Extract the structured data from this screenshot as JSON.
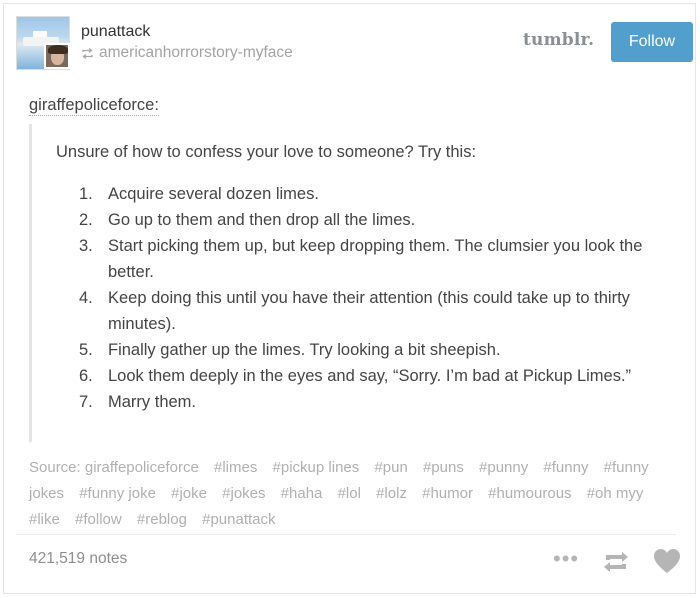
{
  "header": {
    "username": "punattack",
    "reblogged_from": "americanhorrorstory-myface",
    "logo": "tumblr.",
    "follow_label": "Follow"
  },
  "post": {
    "source_user": "giraffepoliceforce:",
    "intro": "Unsure of how to confess your love to someone? Try this:",
    "steps": [
      {
        "num": "1.",
        "text": "Acquire several dozen limes."
      },
      {
        "num": "2.",
        "text": "Go up to them and then drop all the limes."
      },
      {
        "num": "3.",
        "text": "Start picking them up, but keep dropping them. The clumsier you look the better."
      },
      {
        "num": "4.",
        "text": "Keep doing this until you have their attention (this could take up to thirty minutes)."
      },
      {
        "num": "5.",
        "text": "Finally gather up the limes. Try looking a bit sheepish."
      },
      {
        "num": "6.",
        "text": "Look them deeply in the eyes and say, “Sorry. I’m bad at Pickup Limes.”"
      },
      {
        "num": "7.",
        "text": "Marry them."
      }
    ]
  },
  "tags": [
    "Source: giraffepoliceforce",
    "#limes",
    "#pickup lines",
    "#pun",
    "#puns",
    "#punny",
    "#funny",
    "#funny jokes",
    "#funny joke",
    "#joke",
    "#jokes",
    "#haha",
    "#lol",
    "#lolz",
    "#humor",
    "#humourous",
    "#oh myy",
    "#like",
    "#follow",
    "#reblog",
    "#punattack"
  ],
  "footer": {
    "notes": "421,519 notes",
    "icons": [
      "more-icon",
      "reblog-icon",
      "heart-icon"
    ]
  },
  "colors": {
    "follow_button": "#529ecc",
    "tag_text": "#b0b0b0"
  }
}
